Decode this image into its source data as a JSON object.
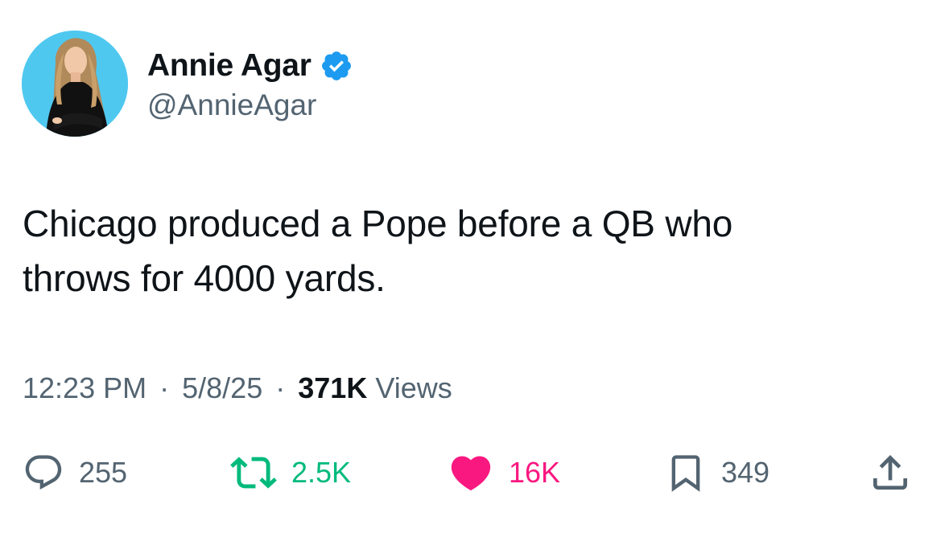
{
  "author": {
    "display_name": "Annie Agar",
    "handle": "@AnnieAgar",
    "verified": true,
    "avatar_icon": "profile-photo",
    "verified_color": "#1d9bf0"
  },
  "tweet": {
    "text_line1": "Chicago produced a Pope before a QB who",
    "text_line2": "throws for 4000 yards."
  },
  "meta": {
    "time": "12:23 PM",
    "separator": "·",
    "date": "5/8/25",
    "views_count": "371K",
    "views_label": "Views"
  },
  "actions": {
    "reply": {
      "icon": "reply-icon",
      "count": "255"
    },
    "retweet": {
      "icon": "retweet-icon",
      "count": "2.5K",
      "color": "#00ba7c"
    },
    "like": {
      "icon": "heart-icon",
      "count": "16K",
      "color": "#f91880"
    },
    "bookmark": {
      "icon": "bookmark-icon",
      "count": "349"
    },
    "share": {
      "icon": "share-icon"
    }
  },
  "colors": {
    "text_primary": "#0f1419",
    "text_secondary": "#536471",
    "avatar_background": "#4fc8f0"
  }
}
